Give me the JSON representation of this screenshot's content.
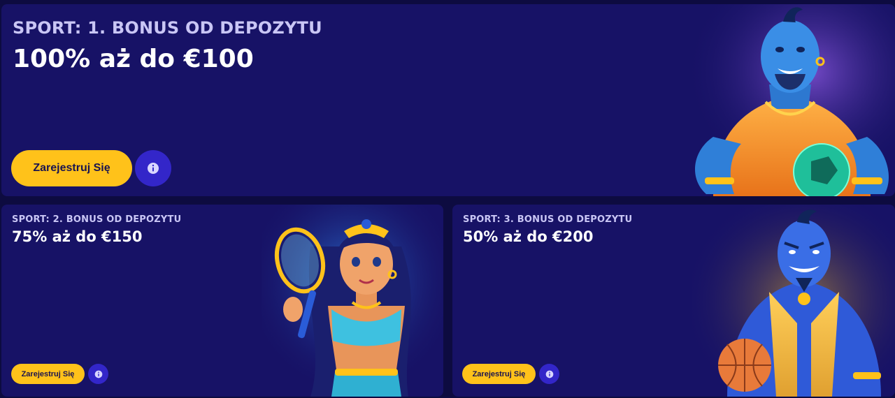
{
  "promos": [
    {
      "subtitle": "SPORT: 1. BONUS OD DEPOZYTU",
      "title": "100% aż do €100",
      "register_label": "Zarejestruj Się",
      "info_icon": "info-icon",
      "illustration": "genie-with-soccer-ball"
    },
    {
      "subtitle": "SPORT: 2. BONUS OD DEPOZYTU",
      "title": "75% aż do €150",
      "register_label": "Zarejestruj Się",
      "info_icon": "info-icon",
      "illustration": "princess-with-tennis-racket"
    },
    {
      "subtitle": "SPORT: 3. BONUS OD DEPOZYTU",
      "title": "50% aż do €200",
      "register_label": "Zarejestruj Się",
      "info_icon": "info-icon",
      "illustration": "genie-with-basketball"
    }
  ],
  "colors": {
    "background": "#0d0b40",
    "card": "#171266",
    "button": "#ffc21a",
    "info_button": "#3326c9"
  }
}
